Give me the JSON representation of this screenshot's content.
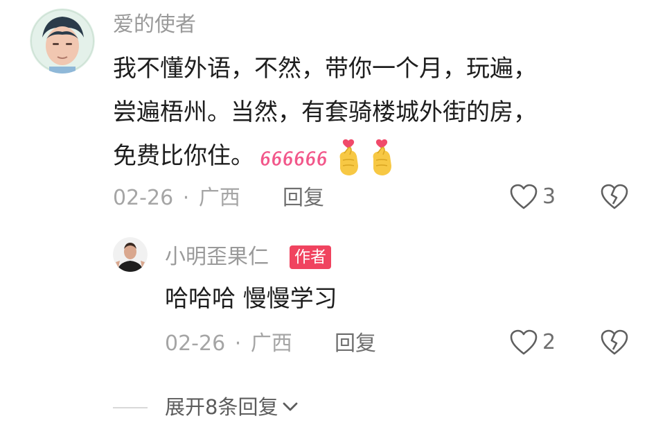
{
  "comment": {
    "username": "爱的使者",
    "lines": [
      "我不懂外语，不然，带你一个月，玩遍，",
      "尝遍梧州。当然，有套骑楼城外街的房，",
      "免费比你住。"
    ],
    "emoji": "666666",
    "date": "02-26",
    "separator": "·",
    "location": "广西",
    "reply_label": "回复",
    "like_count": "3"
  },
  "reply": {
    "username": "小明歪果仁",
    "badge": "作者",
    "text": "哈哈哈 慢慢学习",
    "date": "02-26",
    "separator": "·",
    "location": "广西",
    "reply_label": "回复",
    "like_count": "2"
  },
  "expand": {
    "label": "展开8条回复"
  },
  "colors": {
    "badge": "#f0435f",
    "username": "#9a9a9a",
    "text": "#1d1d1d",
    "emoji_pink": "#f2578a"
  }
}
